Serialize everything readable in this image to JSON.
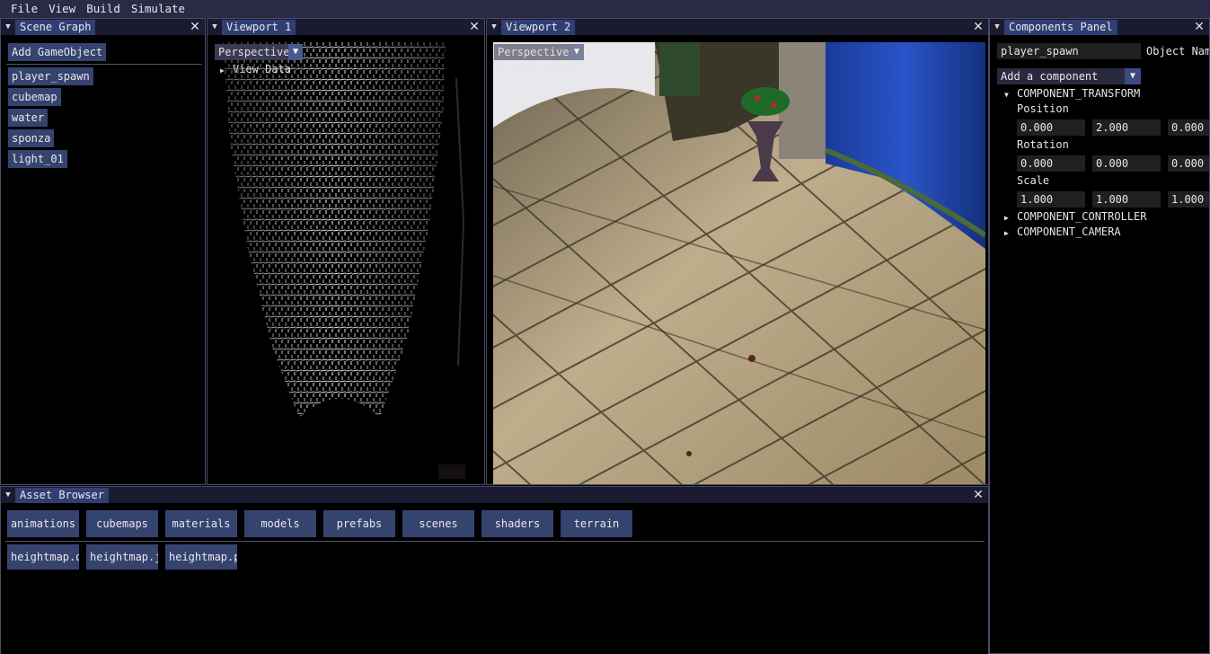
{
  "menubar": {
    "items": [
      "File",
      "View",
      "Build",
      "Simulate"
    ]
  },
  "scene_graph": {
    "title": "Scene Graph",
    "add_button": "Add GameObject",
    "objects": [
      "player_spawn",
      "cubemap",
      "water",
      "sponza",
      "light_01"
    ]
  },
  "viewport1": {
    "title": "Viewport 1",
    "projection": "Perspective",
    "view_data": "View Data"
  },
  "viewport2": {
    "title": "Viewport 2",
    "projection": "Perspective",
    "view_data": "View Data"
  },
  "components": {
    "title": "Components Panel",
    "object_name_value": "player_spawn",
    "object_name_label": "Object Nam",
    "add_component": "Add a component",
    "transform": {
      "header": "COMPONENT_TRANSFORM",
      "position_label": "Position",
      "position": [
        "0.000",
        "2.000",
        "0.000"
      ],
      "rotation_label": "Rotation",
      "rotation": [
        "0.000",
        "0.000",
        "0.000"
      ],
      "scale_label": "Scale",
      "scale": [
        "1.000",
        "1.000",
        "1.000"
      ]
    },
    "controller_header": "COMPONENT_CONTROLLER",
    "camera_header": "COMPONENT_CAMERA"
  },
  "asset_browser": {
    "title": "Asset Browser",
    "folders": [
      "animations",
      "cubemaps",
      "materials",
      "models",
      "prefabs",
      "scenes",
      "shaders",
      "terrain"
    ],
    "files": [
      "heightmap.d",
      "heightmap.j",
      "heightmap.p"
    ]
  },
  "colors": {
    "accent": "#2f3f73",
    "button": "#35436f",
    "menubar": "#2a2a46"
  },
  "icons": {
    "collapse": "collapse-triangle-icon",
    "close": "close-x-icon",
    "dropdown": "dropdown-arrow-icon"
  }
}
